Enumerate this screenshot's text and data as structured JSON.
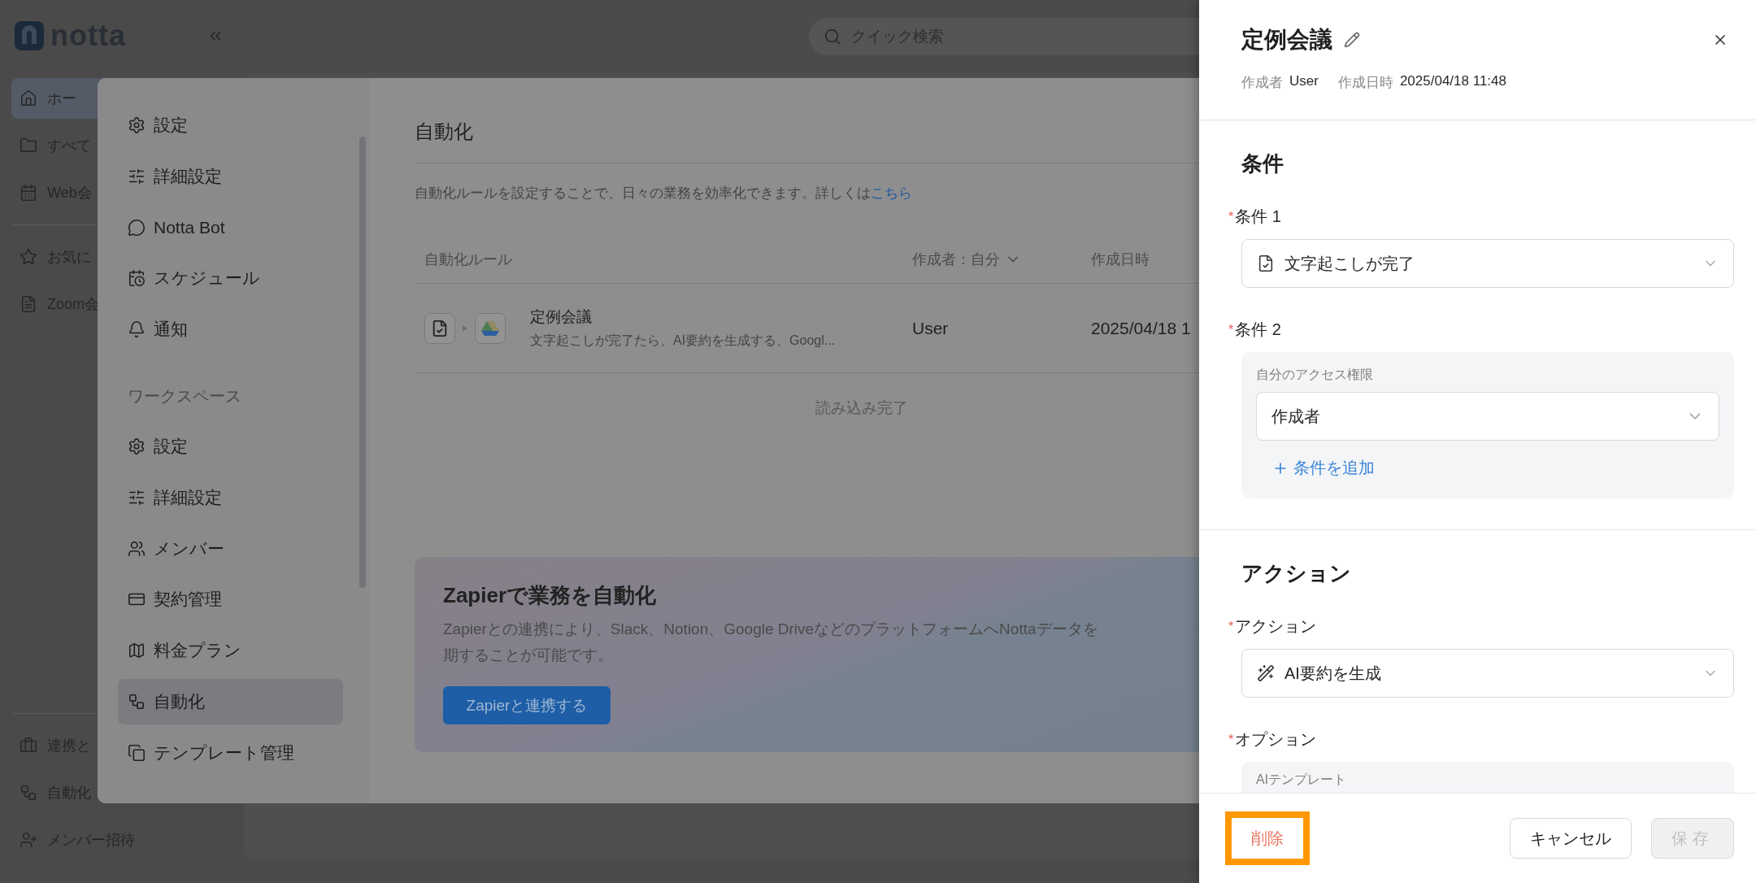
{
  "app": {
    "logo": "notta",
    "search_placeholder": "クイック検索",
    "nav_top": [
      {
        "label": "ホー",
        "selected": true
      },
      {
        "label": "すべて",
        "selected": false
      },
      {
        "label": "Web会",
        "selected": false
      }
    ],
    "nav_pinned": [
      {
        "label": "お気に",
        "selected": false
      },
      {
        "label": "Zoom会",
        "selected": false
      }
    ],
    "nav_bottom": [
      {
        "label": "連携と",
        "selected": false
      },
      {
        "label": "自動化",
        "selected": false
      },
      {
        "label": "メンバー招待",
        "selected": false
      }
    ]
  },
  "settings": {
    "personal": [
      {
        "label": "設定",
        "selected": false
      },
      {
        "label": "詳細設定",
        "selected": false
      },
      {
        "label": "Notta Bot",
        "selected": false
      },
      {
        "label": "スケジュール",
        "selected": false
      },
      {
        "label": "通知",
        "selected": false
      }
    ],
    "workspace_heading": "ワークスペース",
    "workspace": [
      {
        "label": "設定",
        "selected": false
      },
      {
        "label": "詳細設定",
        "selected": false
      },
      {
        "label": "メンバー",
        "selected": false
      },
      {
        "label": "契約管理",
        "selected": false
      },
      {
        "label": "料金プラン",
        "selected": false
      },
      {
        "label": "自動化",
        "selected": true
      },
      {
        "label": "テンプレート管理",
        "selected": false
      }
    ],
    "page": {
      "title": "自動化",
      "description": "自動化ルールを設定することで、日々の業務を効率化できます。詳しくは",
      "link": "こちら",
      "columns": [
        {
          "label": "自動化ルール",
          "dropdown": false
        },
        {
          "label": "作成者：自分",
          "dropdown": true
        },
        {
          "label": "作成日時",
          "dropdown": false
        }
      ],
      "rows": [
        {
          "title": "定例会議",
          "summary": "文字起こしが完了たら、AI要約を生成する、Googl...",
          "creator": "User",
          "created": "2025/04/18 1"
        }
      ],
      "status": "読み込み完了",
      "promo": {
        "title": "Zapierで業務を自動化",
        "description_lines": [
          "Zapierとの連携により、Slack、Notion、Google DriveなどのプラットフォームへNottaデータを",
          "期することが可能です。"
        ],
        "button": "Zapierと連携する"
      }
    }
  },
  "drawer": {
    "title": "定例会議",
    "meta": [
      {
        "label": "作成者",
        "value": "User"
      },
      {
        "label": "作成日時",
        "value": "2025/04/18 11:48"
      }
    ],
    "sections": [
      {
        "heading": "条件",
        "fields": [
          {
            "kind": "select",
            "mark": "*",
            "label": "条件 1",
            "value": "文字起こしが完了"
          },
          {
            "kind": "group",
            "mark": "*",
            "label": "条件 2",
            "sublabel": "自分のアクセス権限",
            "value": "作成者",
            "add_link": "条件を追加"
          }
        ]
      },
      {
        "heading": "アクション",
        "fields": [
          {
            "kind": "select",
            "mark": "*",
            "label": "アクション",
            "value": "AI要約を生成"
          },
          {
            "kind": "peek",
            "mark": "*",
            "label": "オプション",
            "sublabel": "AIテンプレート"
          }
        ]
      }
    ],
    "delete_button": {
      "label": "削除",
      "highlighted": true
    },
    "cancel_button": {
      "label": "キャンセル"
    },
    "save_button": {
      "label": "保存",
      "disabled": true
    }
  }
}
